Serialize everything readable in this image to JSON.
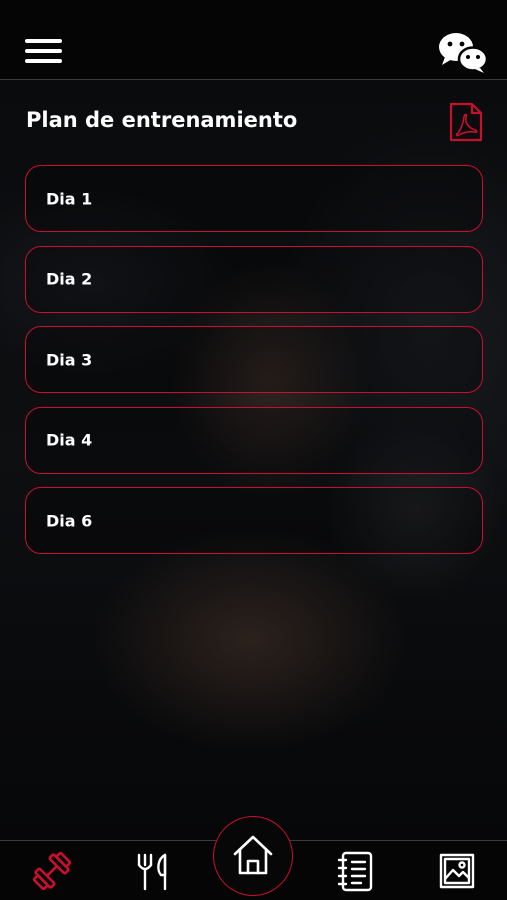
{
  "header": {
    "menu_icon": "hamburger-menu-icon",
    "chat_icon": "wechat-icon"
  },
  "main": {
    "title": "Plan de entrenamiento",
    "pdf_icon": "pdf-file-icon",
    "days": [
      {
        "label": "Dia 1"
      },
      {
        "label": "Dia 2"
      },
      {
        "label": "Dia 3"
      },
      {
        "label": "Dia 4"
      },
      {
        "label": "Dia 6"
      }
    ]
  },
  "bottom_nav": {
    "items": [
      {
        "icon": "dumbbell-icon",
        "active": true
      },
      {
        "icon": "fork-knife-icon",
        "active": false
      },
      {
        "icon": "home-icon",
        "active": false
      },
      {
        "icon": "notebook-icon",
        "active": false
      },
      {
        "icon": "gallery-icon",
        "active": false
      }
    ]
  },
  "colors": {
    "accent": "#c8102e",
    "background": "#000000",
    "text": "#ffffff"
  }
}
